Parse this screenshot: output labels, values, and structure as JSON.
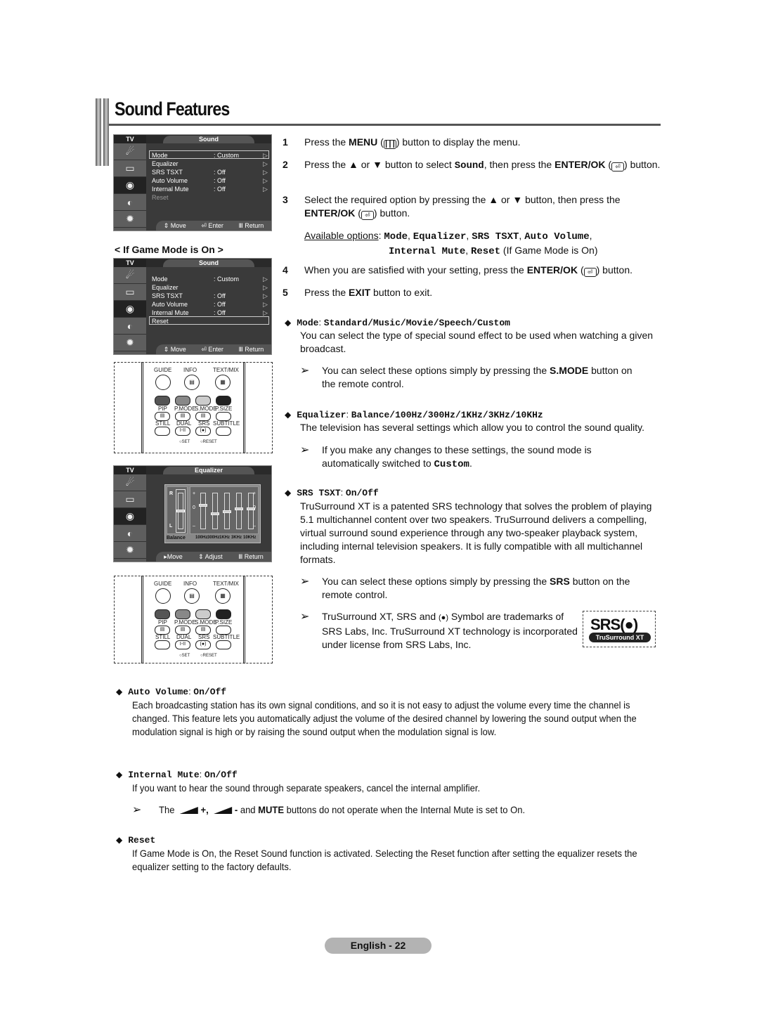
{
  "page": {
    "title": "Sound Features",
    "page_label": "English - 22"
  },
  "osd_sound": {
    "tv_tab": "TV",
    "header": "Sound",
    "rows": [
      {
        "label": "Mode",
        "value": ": Custom",
        "arrow": "▷"
      },
      {
        "label": "Equalizer",
        "value": "",
        "arrow": "▷"
      },
      {
        "label": "SRS TSXT",
        "value": ": Off",
        "arrow": "▷"
      },
      {
        "label": "Auto Volume",
        "value": ": Off",
        "arrow": "▷"
      },
      {
        "label": "Internal Mute",
        "value": ": Off",
        "arrow": "▷"
      },
      {
        "label": "Reset",
        "value": "",
        "arrow": ""
      }
    ],
    "footer": {
      "move": "⇕ Move",
      "enter": "⏎ Enter",
      "return": "Ⅲ Return"
    }
  },
  "game_mode_caption": "< If Game Mode is On >",
  "osd_game": {
    "tv_tab": "TV",
    "header": "Sound",
    "rows": [
      {
        "label": "Mode",
        "value": ": Custom",
        "arrow": "▷"
      },
      {
        "label": "Equalizer",
        "value": "",
        "arrow": "▷"
      },
      {
        "label": "SRS TSXT",
        "value": ": Off",
        "arrow": "▷"
      },
      {
        "label": "Auto Volume",
        "value": ": Off",
        "arrow": "▷"
      },
      {
        "label": "Internal Mute",
        "value": ": Off",
        "arrow": "▷"
      },
      {
        "label": "Reset",
        "value": "",
        "arrow": ""
      }
    ],
    "footer": {
      "move": "⇕ Move",
      "enter": "⏎ Enter",
      "return": "Ⅲ Return"
    }
  },
  "remote1": {
    "labels": {
      "guide": "GUIDE",
      "info": "INFO",
      "text_mix": "TEXT/MIX",
      "pip": "PIP",
      "pmode": "P.MODE",
      "smode": "S.MODE",
      "psize": "P.SIZE",
      "still": "STILL",
      "dual": "DUAL",
      "srs": "SRS",
      "subtitle": "SUBTITLE",
      "set": "SET",
      "reset": "RESET",
      "dual_btn": "I-II",
      "srs_btn": "(●)"
    },
    "highlight": "S.MODE"
  },
  "osd_equalizer": {
    "tv_tab": "TV",
    "header": "Equalizer",
    "balance_label": "Balance",
    "balance_marks": {
      "top": "R",
      "bottom": "L"
    },
    "scale_marks": {
      "plus": "+",
      "zero": "0",
      "minus": "–"
    },
    "bands": [
      {
        "label": "100Hz",
        "level": 0.3
      },
      {
        "label": "300Hz",
        "level": -0.15
      },
      {
        "label": "1KHz",
        "level": -0.05
      },
      {
        "label": "3KHz",
        "level": 0.1
      },
      {
        "label": "10KHz",
        "level": 0.1
      }
    ],
    "balance_level": 0.0,
    "footer": {
      "move": "▸Move",
      "adjust": "⇕ Adjust",
      "return": "Ⅲ Return"
    }
  },
  "remote2": {
    "labels": {
      "guide": "GUIDE",
      "info": "INFO",
      "text_mix": "TEXT/MIX",
      "pip": "PIP",
      "pmode": "P.MODE",
      "smode": "S.MODE",
      "psize": "P.SIZE",
      "still": "STILL",
      "dual": "DUAL",
      "srs": "SRS",
      "subtitle": "SUBTITLE",
      "set": "SET",
      "reset": "RESET",
      "dual_btn": "I-II",
      "srs_btn": "(●)"
    },
    "highlight": "SRS"
  },
  "steps": [
    {
      "num": "1",
      "pre": "Press the ",
      "bold": "MENU",
      "icon": "menu-icon",
      "post": " button to display the menu."
    },
    {
      "num": "2",
      "pre": "Press the ▲ or ▼ button to select ",
      "mono": "Sound",
      "mid": ", then press the ",
      "bold": "ENTER/OK",
      "icon": "enter-icon",
      "post": " button."
    },
    {
      "num": "3",
      "pre": "Select the required option by pressing the ▲ or ▼ button, then press the ",
      "bold": "ENTER/OK",
      "icon": "enter-icon",
      "post": " button."
    },
    {
      "num": "4",
      "pre": "When you are satisfied with your setting, press the ",
      "bold": "ENTER/OK",
      "icon": "enter-icon",
      "post": " button."
    },
    {
      "num": "5",
      "pre": "Press the ",
      "bold": "EXIT",
      "post": " button to exit."
    }
  ],
  "available_options": {
    "label": "Available options",
    "options": [
      "Mode",
      "Equalizer",
      "SRS TSXT",
      "Auto Volume",
      "Internal Mute",
      "Reset"
    ],
    "suffix": "(If Game Mode is On)"
  },
  "sections": {
    "mode": {
      "name": "Mode",
      "values": "Standard/Music/Movie/Speech/Custom",
      "desc": "You can select the type of special sound effect to be used when watching a given broadcast.",
      "note_pre": "You can select these options simply by pressing the ",
      "note_bold": "S.MODE",
      "note_post": " button on the remote control."
    },
    "equalizer": {
      "name": "Equalizer",
      "values": "Balance/100Hz/300Hz/1KHz/3KHz/10KHz",
      "desc": "The television has several settings which allow you to control the sound quality.",
      "note_pre": "If you make any changes to these settings, the sound mode is automatically switched to ",
      "note_mono": "Custom",
      "note_post": "."
    },
    "srs": {
      "name": "SRS TSXT",
      "values": "On/Off",
      "desc": "TruSurround XT is a patented SRS technology that solves the problem of playing 5.1 multichannel content over two speakers.  TruSurround delivers a compelling, virtual surround sound experience through any two-speaker playback system, including internal television speakers. It is fully compatible with all multichannel formats.",
      "note1_pre": "You can select these options simply by pressing the ",
      "note1_bold": "SRS",
      "note1_post": " button on the remote control.",
      "note2_a": "TruSurround XT, SRS and ",
      "note2_symbol": "(●)",
      "note2_b": " Symbol are trademarks of SRS Labs, Inc. TruSurround XT technology is incorporated under license from SRS Labs, Inc.",
      "logo_top": "SRS(●)",
      "logo_bottom": "TruSurround XT"
    },
    "auto_volume": {
      "name": "Auto Volume",
      "values": "On/Off",
      "desc": "Each broadcasting station has its own signal conditions, and so it is not easy to adjust the volume every time the channel is changed. This feature lets you automatically adjust the volume of the desired channel by lowering the sound output when the modulation signal is high or by raising the sound output when the modulation signal is low."
    },
    "internal_mute": {
      "name": "Internal Mute",
      "values": "On/Off",
      "desc": "If you want to hear the sound through separate speakers, cancel the internal amplifier.",
      "note_a": "The ",
      "note_plus": "+,",
      "note_minus": "-",
      "note_and": " and ",
      "note_bold": "MUTE",
      "note_post": " buttons do not operate when the Internal Mute is set to On."
    },
    "reset": {
      "name": "Reset",
      "desc": "If Game Mode is On, the Reset Sound function is activated. Selecting the Reset function after setting the equalizer resets the equalizer setting to the factory defaults."
    }
  }
}
